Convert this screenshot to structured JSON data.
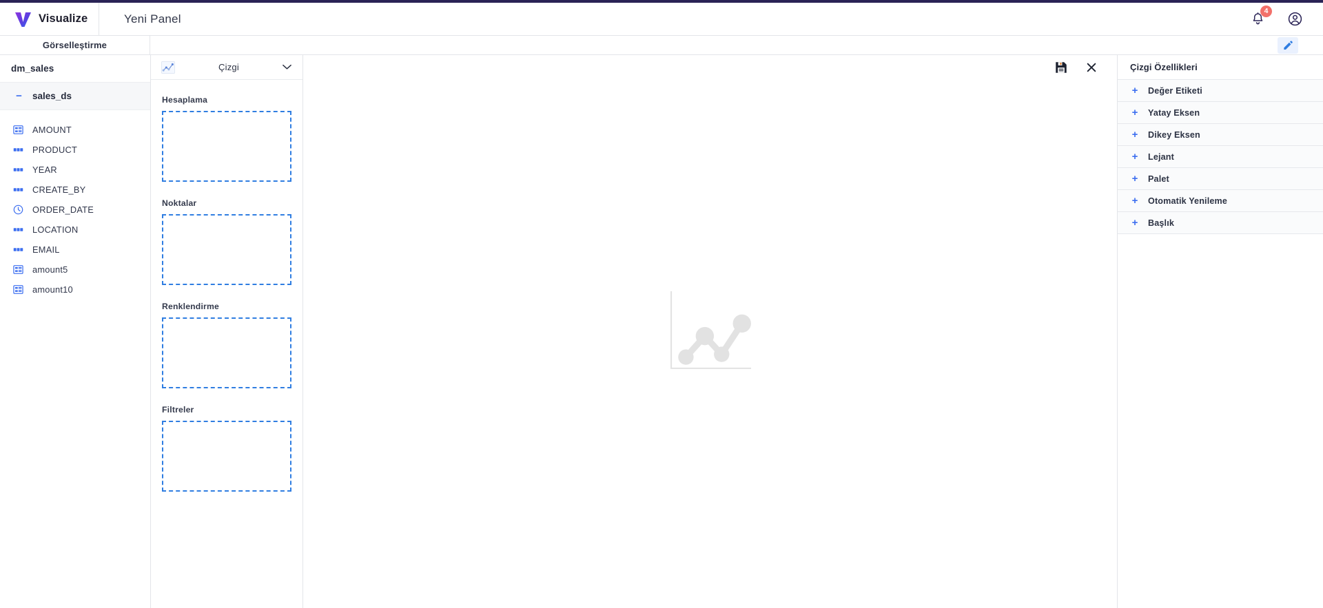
{
  "app": {
    "brand_name": "Visualize",
    "logo_icon": "visualize-v-logo",
    "panel_title": "Yeni Panel",
    "accent_color": "#2a2356",
    "primary_blue": "#3c6ef0",
    "dashed_blue": "#2f7de1",
    "badge_color": "#f2706a"
  },
  "topbar": {
    "notifications_icon": "bell-icon",
    "notifications_count": "4",
    "account_icon": "user-account-icon"
  },
  "subbar": {
    "tab_label": "Görselleştirme",
    "edit_icon": "pencil-edit-icon"
  },
  "fields_panel": {
    "datasource_name": "dm_sales",
    "dataset_name": "sales_ds",
    "collapse_toggle": "−",
    "fields": [
      {
        "name": "AMOUNT",
        "type": "number",
        "icon": "number-field-icon"
      },
      {
        "name": "PRODUCT",
        "type": "text",
        "icon": "abc-text-field-icon"
      },
      {
        "name": "YEAR",
        "type": "text",
        "icon": "abc-text-field-icon"
      },
      {
        "name": "CREATE_BY",
        "type": "text",
        "icon": "abc-text-field-icon"
      },
      {
        "name": "ORDER_DATE",
        "type": "date",
        "icon": "clock-date-field-icon"
      },
      {
        "name": "LOCATION",
        "type": "text",
        "icon": "abc-text-field-icon"
      },
      {
        "name": "EMAIL",
        "type": "text",
        "icon": "abc-text-field-icon"
      },
      {
        "name": "amount5",
        "type": "number",
        "icon": "number-field-icon"
      },
      {
        "name": "amount10",
        "type": "number",
        "icon": "number-field-icon"
      }
    ]
  },
  "shelves_panel": {
    "chart_type": {
      "label": "Çizgi",
      "icon": "line-chart-icon",
      "chevron": "chevron-down-icon"
    },
    "shelves": [
      {
        "label": "Hesaplama",
        "items": []
      },
      {
        "label": "Noktalar",
        "items": []
      },
      {
        "label": "Renklendirme",
        "items": []
      },
      {
        "label": "Filtreler",
        "items": []
      }
    ]
  },
  "canvas": {
    "save_icon": "save-floppy-icon",
    "close_icon": "close-x-icon",
    "placeholder_icon": "line-chart-placeholder-icon"
  },
  "properties_panel": {
    "title": "Çizgi Özellikleri",
    "items": [
      {
        "label": "Değer Etiketi",
        "expander": "+"
      },
      {
        "label": "Yatay Eksen",
        "expander": "+"
      },
      {
        "label": "Dikey Eksen",
        "expander": "+"
      },
      {
        "label": "Lejant",
        "expander": "+"
      },
      {
        "label": "Palet",
        "expander": "+"
      },
      {
        "label": "Otomatik Yenileme",
        "expander": "+"
      },
      {
        "label": "Başlık",
        "expander": "+"
      }
    ]
  }
}
